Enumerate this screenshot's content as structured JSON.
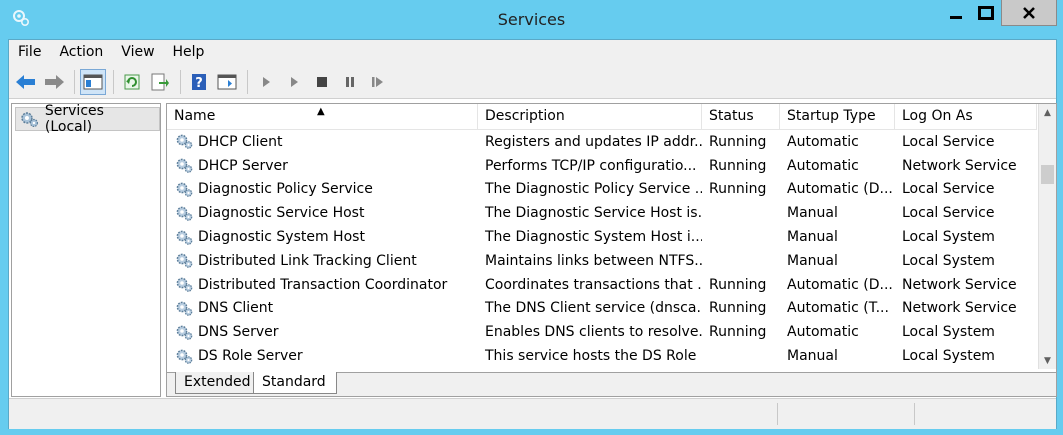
{
  "window": {
    "title": "Services"
  },
  "menu": [
    {
      "label": "File"
    },
    {
      "label": "Action"
    },
    {
      "label": "View"
    },
    {
      "label": "Help"
    }
  ],
  "toolbar": {
    "buttons": [
      "back-icon",
      "forward-icon",
      "show-hide-console-tree-icon",
      "refresh-icon",
      "export-list-icon",
      "help-icon",
      "properties-icon",
      "start-service-icon",
      "start-service-params-icon",
      "stop-service-icon",
      "pause-service-icon",
      "resume-service-icon"
    ]
  },
  "tree": {
    "root_label": "Services (Local)"
  },
  "columns": [
    {
      "label": "Name"
    },
    {
      "label": "Description"
    },
    {
      "label": "Status"
    },
    {
      "label": "Startup Type"
    },
    {
      "label": "Log On As"
    }
  ],
  "rows": [
    {
      "name": "DHCP Client",
      "desc": "Registers and updates IP addr...",
      "status": "Running",
      "startup": "Automatic",
      "logon": "Local Service"
    },
    {
      "name": "DHCP Server",
      "desc": "Performs TCP/IP configuratio...",
      "status": "Running",
      "startup": "Automatic",
      "logon": "Network Service"
    },
    {
      "name": "Diagnostic Policy Service",
      "desc": "The Diagnostic Policy Service ...",
      "status": "Running",
      "startup": "Automatic (D...",
      "logon": "Local Service"
    },
    {
      "name": "Diagnostic Service Host",
      "desc": "The Diagnostic Service Host is...",
      "status": "",
      "startup": "Manual",
      "logon": "Local Service"
    },
    {
      "name": "Diagnostic System Host",
      "desc": "The Diagnostic System Host i...",
      "status": "",
      "startup": "Manual",
      "logon": "Local System"
    },
    {
      "name": "Distributed Link Tracking Client",
      "desc": "Maintains links between NTFS...",
      "status": "",
      "startup": "Manual",
      "logon": "Local System"
    },
    {
      "name": "Distributed Transaction Coordinator",
      "desc": "Coordinates transactions that ...",
      "status": "Running",
      "startup": "Automatic (D...",
      "logon": "Network Service"
    },
    {
      "name": "DNS Client",
      "desc": "The DNS Client service (dnsca...",
      "status": "Running",
      "startup": "Automatic (T...",
      "logon": "Network Service"
    },
    {
      "name": "DNS Server",
      "desc": "Enables DNS clients to resolve...",
      "status": "Running",
      "startup": "Automatic",
      "logon": "Local System"
    },
    {
      "name": "DS Role Server",
      "desc": "This service hosts the DS Role ...",
      "status": "",
      "startup": "Manual",
      "logon": "Local System"
    }
  ],
  "tabs": [
    {
      "label": "Extended"
    },
    {
      "label": "Standard"
    }
  ],
  "colors": {
    "accent": "#66ccef",
    "close_button": "#c9c9c9"
  }
}
